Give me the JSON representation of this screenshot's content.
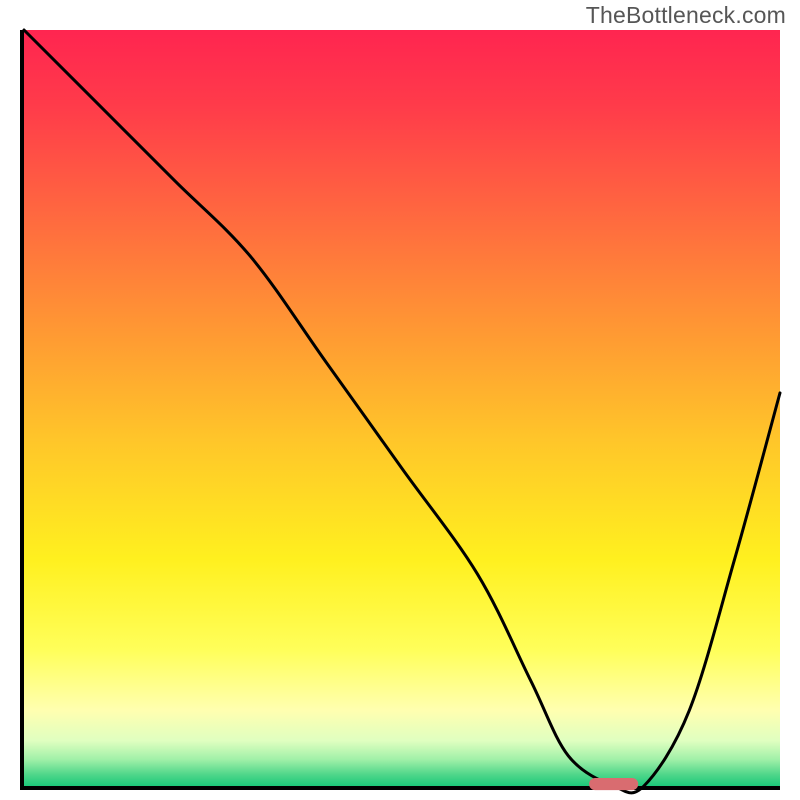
{
  "attribution": "TheBottleneck.com",
  "chart_data": {
    "type": "line",
    "title": "",
    "xlabel": "",
    "ylabel": "",
    "xlim": [
      0,
      100
    ],
    "ylim": [
      0,
      100
    ],
    "grid": false,
    "legend": false,
    "background_gradient_stops": [
      {
        "pos": 0.0,
        "color": "#ff2550"
      },
      {
        "pos": 0.1,
        "color": "#ff3b4a"
      },
      {
        "pos": 0.25,
        "color": "#ff6a3f"
      },
      {
        "pos": 0.4,
        "color": "#ff9933"
      },
      {
        "pos": 0.55,
        "color": "#ffc829"
      },
      {
        "pos": 0.7,
        "color": "#fff01f"
      },
      {
        "pos": 0.82,
        "color": "#ffff5a"
      },
      {
        "pos": 0.9,
        "color": "#ffffb0"
      },
      {
        "pos": 0.94,
        "color": "#e0ffc0"
      },
      {
        "pos": 0.965,
        "color": "#a0f0a8"
      },
      {
        "pos": 0.985,
        "color": "#4fd68a"
      },
      {
        "pos": 1.0,
        "color": "#1cc97a"
      }
    ],
    "series": [
      {
        "name": "bottleneck-curve",
        "x": [
          0,
          10,
          20,
          30,
          40,
          50,
          60,
          67,
          72,
          78,
          82,
          88,
          94,
          100
        ],
        "y": [
          100,
          90,
          80,
          70,
          56,
          42,
          28,
          14,
          4,
          0,
          0,
          10,
          30,
          52
        ]
      }
    ],
    "marker": {
      "name": "optimal-point",
      "x": 78,
      "y": 0,
      "width": 6.5,
      "height": 1.6,
      "color": "#d96c70"
    }
  }
}
